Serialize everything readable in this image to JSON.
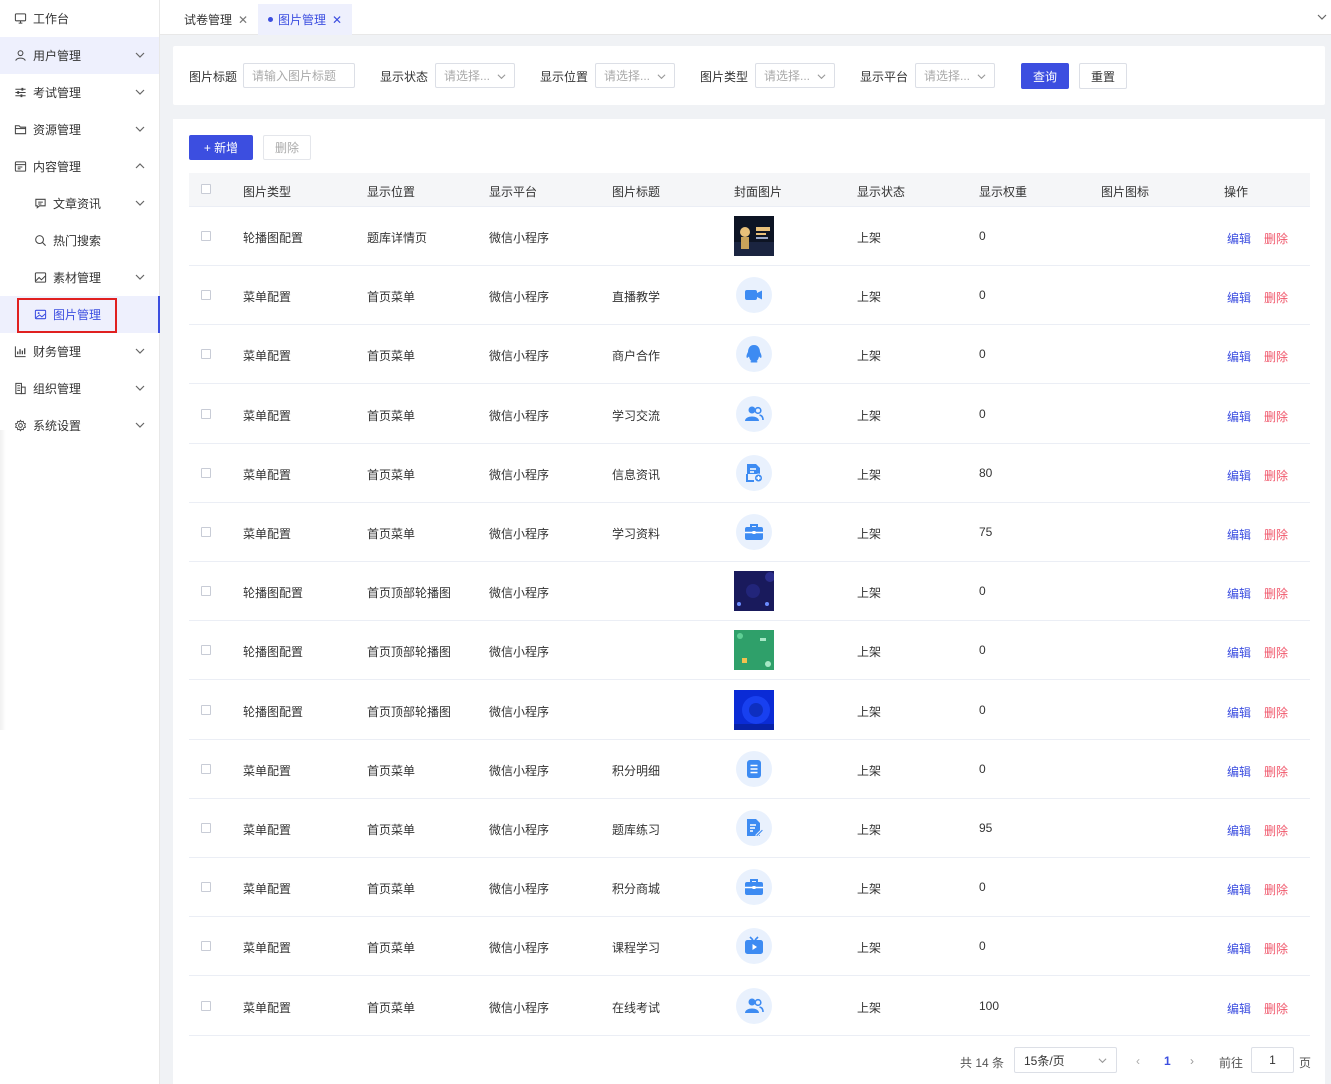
{
  "sidebar": {
    "items": [
      {
        "label": "工作台",
        "icon": "monitor-icon",
        "chevron": "",
        "level": 0,
        "state": ""
      },
      {
        "label": "用户管理",
        "icon": "user-icon",
        "chevron": "down",
        "level": 0,
        "state": "highlight"
      },
      {
        "label": "考试管理",
        "icon": "sliders-icon",
        "chevron": "down",
        "level": 0,
        "state": ""
      },
      {
        "label": "资源管理",
        "icon": "folder-icon",
        "chevron": "down",
        "level": 0,
        "state": ""
      },
      {
        "label": "内容管理",
        "icon": "layout-icon",
        "chevron": "up",
        "level": 0,
        "state": ""
      },
      {
        "label": "文章资讯",
        "icon": "message-icon",
        "chevron": "down",
        "level": 1,
        "state": ""
      },
      {
        "label": "热门搜索",
        "icon": "search-icon",
        "chevron": "",
        "level": 1,
        "state": ""
      },
      {
        "label": "素材管理",
        "icon": "image-icon",
        "chevron": "down",
        "level": 1,
        "state": ""
      },
      {
        "label": "图片管理",
        "icon": "picture-icon",
        "chevron": "",
        "level": 1,
        "state": "active"
      },
      {
        "label": "财务管理",
        "icon": "chart-icon",
        "chevron": "down",
        "level": 0,
        "state": ""
      },
      {
        "label": "组织管理",
        "icon": "building-icon",
        "chevron": "down",
        "level": 0,
        "state": ""
      },
      {
        "label": "系统设置",
        "icon": "gear-icon",
        "chevron": "down",
        "level": 0,
        "state": ""
      }
    ]
  },
  "tabs": [
    {
      "label": "试卷管理",
      "active": false
    },
    {
      "label": "图片管理",
      "active": true
    }
  ],
  "filters": {
    "title_label": "图片标题",
    "title_placeholder": "请输入图片标题",
    "status_label": "显示状态",
    "status_value": "请选择...",
    "position_label": "显示位置",
    "position_value": "请选择...",
    "type_label": "图片类型",
    "type_value": "请选择...",
    "platform_label": "显示平台",
    "platform_value": "请选择...",
    "query_button": "查询",
    "reset_button": "重置"
  },
  "toolbar": {
    "add_button": "+ 新增",
    "delete_button": "删除"
  },
  "table": {
    "columns": [
      "图片类型",
      "显示位置",
      "显示平台",
      "图片标题",
      "封面图片",
      "显示状态",
      "显示权重",
      "图片图标",
      "操作"
    ],
    "edit_label": "编辑",
    "delete_label": "删除",
    "rows": [
      {
        "type": "轮播图配置",
        "position": "题库详情页",
        "platform": "微信小程序",
        "title": "",
        "cover": "photo-dark-banner",
        "status": "上架",
        "weight": "0",
        "icon": ""
      },
      {
        "type": "菜单配置",
        "position": "首页菜单",
        "platform": "微信小程序",
        "title": "直播教学",
        "cover": "video-camera-icon",
        "status": "上架",
        "weight": "0",
        "icon": ""
      },
      {
        "type": "菜单配置",
        "position": "首页菜单",
        "platform": "微信小程序",
        "title": "商户合作",
        "cover": "penguin-icon",
        "status": "上架",
        "weight": "0",
        "icon": ""
      },
      {
        "type": "菜单配置",
        "position": "首页菜单",
        "platform": "微信小程序",
        "title": "学习交流",
        "cover": "users-icon",
        "status": "上架",
        "weight": "0",
        "icon": ""
      },
      {
        "type": "菜单配置",
        "position": "首页菜单",
        "platform": "微信小程序",
        "title": "信息资讯",
        "cover": "doc-add-icon",
        "status": "上架",
        "weight": "80",
        "icon": ""
      },
      {
        "type": "菜单配置",
        "position": "首页菜单",
        "platform": "微信小程序",
        "title": "学习资料",
        "cover": "briefcase-icon",
        "status": "上架",
        "weight": "75",
        "icon": ""
      },
      {
        "type": "轮播图配置",
        "position": "首页顶部轮播图",
        "platform": "微信小程序",
        "title": "",
        "cover": "photo-navy-banner",
        "status": "上架",
        "weight": "0",
        "icon": ""
      },
      {
        "type": "轮播图配置",
        "position": "首页顶部轮播图",
        "platform": "微信小程序",
        "title": "",
        "cover": "photo-green-banner",
        "status": "上架",
        "weight": "0",
        "icon": ""
      },
      {
        "type": "轮播图配置",
        "position": "首页顶部轮播图",
        "platform": "微信小程序",
        "title": "",
        "cover": "photo-blue-banner",
        "status": "上架",
        "weight": "0",
        "icon": ""
      },
      {
        "type": "菜单配置",
        "position": "首页菜单",
        "platform": "微信小程序",
        "title": "积分明细",
        "cover": "list-icon",
        "status": "上架",
        "weight": "0",
        "icon": ""
      },
      {
        "type": "菜单配置",
        "position": "首页菜单",
        "platform": "微信小程序",
        "title": "题库练习",
        "cover": "doc-edit-icon",
        "status": "上架",
        "weight": "95",
        "icon": ""
      },
      {
        "type": "菜单配置",
        "position": "首页菜单",
        "platform": "微信小程序",
        "title": "积分商城",
        "cover": "briefcase-icon",
        "status": "上架",
        "weight": "0",
        "icon": ""
      },
      {
        "type": "菜单配置",
        "position": "首页菜单",
        "platform": "微信小程序",
        "title": "课程学习",
        "cover": "tv-play-icon",
        "status": "上架",
        "weight": "0",
        "icon": ""
      },
      {
        "type": "菜单配置",
        "position": "首页菜单",
        "platform": "微信小程序",
        "title": "在线考试",
        "cover": "users-icon",
        "status": "上架",
        "weight": "100",
        "icon": ""
      }
    ]
  },
  "pagination": {
    "total": "共 14 条",
    "page_size": "15条/页",
    "current_page": "1",
    "goto_label": "前往",
    "goto_value": "1",
    "page_suffix": "页"
  },
  "colors": {
    "primary": "#3c4ee0",
    "danger": "#f0566a",
    "icon_blue": "#3d8bf2",
    "highlight_box": "#e02020"
  }
}
